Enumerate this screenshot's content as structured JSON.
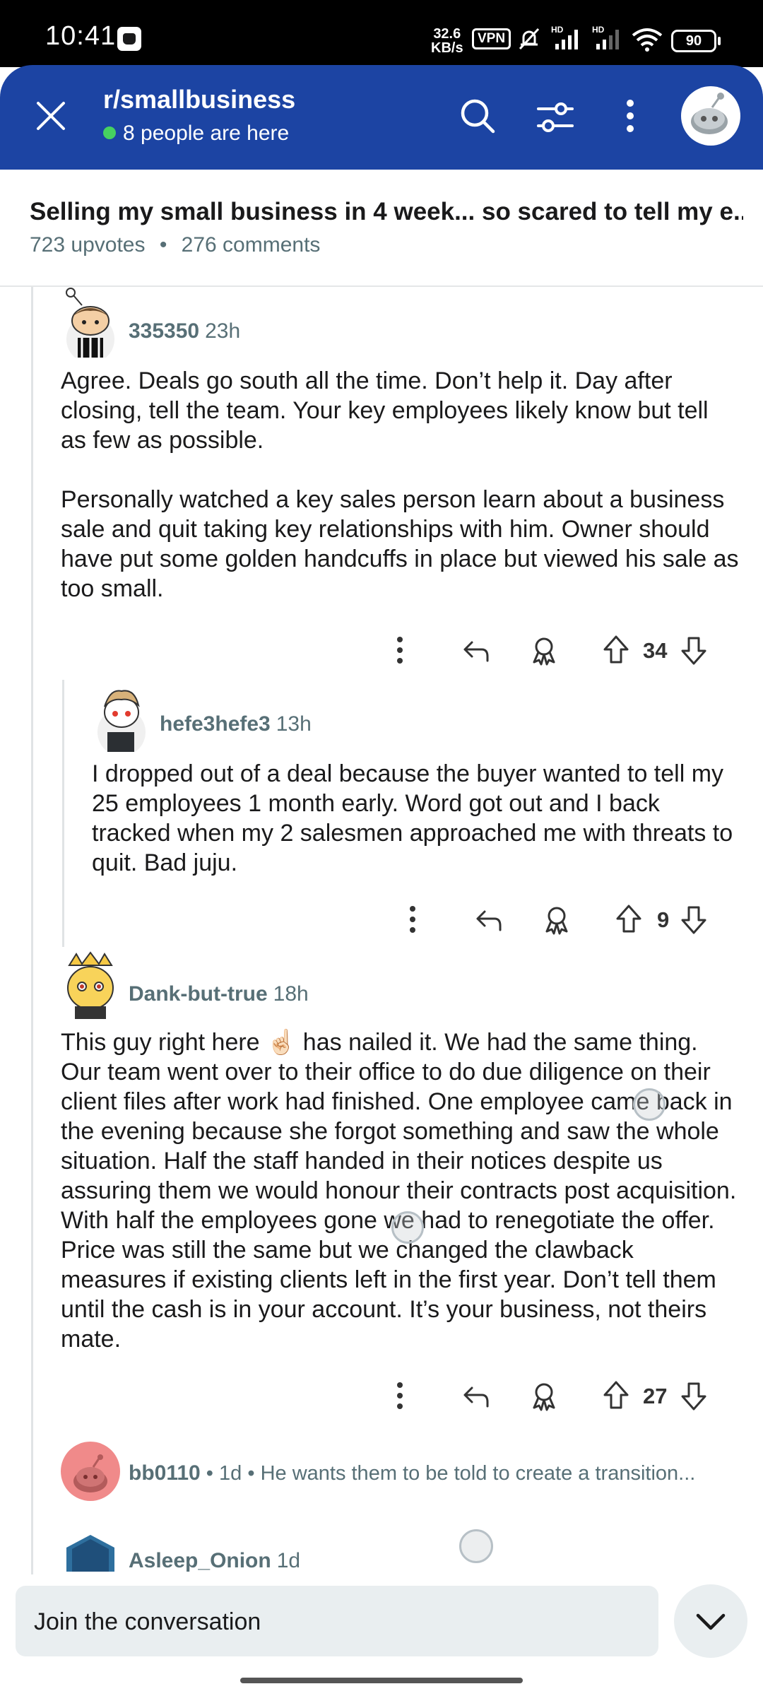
{
  "status_bar": {
    "time": "10:41",
    "speed_value": "32.6",
    "speed_unit": "KB/s",
    "vpn": "VPN",
    "signal1_label": "HD",
    "signal2_label": "HD",
    "battery": "90"
  },
  "header": {
    "subreddit": "r/smallbusiness",
    "online": "8 people are here",
    "online_dot_color": "#46d160",
    "bg_color": "#1c44a3"
  },
  "post": {
    "title": "Selling my small business in 4 week... so scared to tell my e...",
    "upvotes": "723 upvotes",
    "separator": "•",
    "comments": "276 comments"
  },
  "comments": [
    {
      "author": "335350",
      "time": "23h",
      "paragraphs": [
        "Agree. Deals go south all the time. Don’t help it. Day after closing, tell the team. Your key employees likely know but tell as few as possible.",
        "Personally watched a key sales person learn about a business sale and quit taking key relationships with him. Owner should have put some golden handcuffs in place but viewed his sale as too small."
      ],
      "score": "34"
    },
    {
      "author": "hefe3hefe3",
      "time": "13h",
      "paragraphs": [
        "I dropped out of a deal because the buyer wanted to tell my 25 employees 1 month early. Word got out and I back tracked when my 2 salesmen approached me with threats to quit. Bad juju."
      ],
      "score": "9"
    },
    {
      "author": "Dank-but-true",
      "time": "18h",
      "paragraphs": [
        "This guy right here ☝🏻 has nailed it. We had the same thing. Our team went over to their office to do due diligence on their client files after work had finished. One employee came back in the evening because she forgot something and saw the whole situation. Half the staff handed in their notices despite us assuring them we would honour their contracts post acquisition. With half the employees gone we had to renegotiate the offer. Price was still the same but we changed the clawback measures if existing clients left in the first year. Don’t tell them until the cash is in your account. It’s your business, not theirs mate."
      ],
      "score": "27"
    }
  ],
  "collapsed_comment": {
    "author": "bb0110",
    "time": "1d",
    "preview": "He wants them to be told to create a transition..."
  },
  "last_comment": {
    "author": "Asleep_Onion",
    "time": "1d"
  },
  "composer": {
    "placeholder": "Join the conversation"
  }
}
